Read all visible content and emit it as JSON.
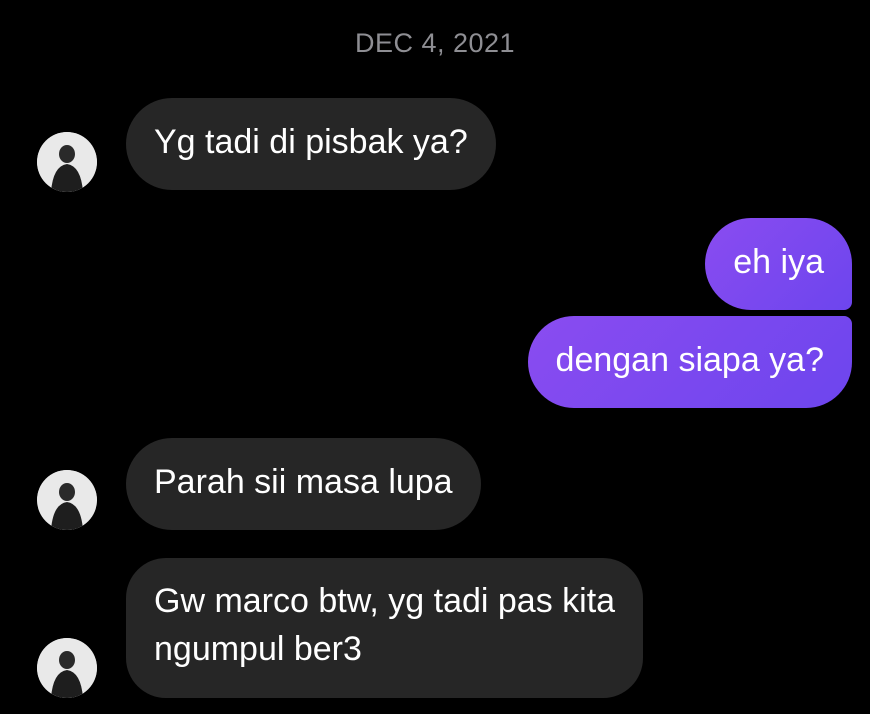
{
  "conversation": {
    "date_divider": "DEC 4, 2021",
    "messages": [
      {
        "direction": "incoming",
        "text": "Yg tadi di pisbak ya?"
      },
      {
        "direction": "outgoing",
        "text": "eh iya"
      },
      {
        "direction": "outgoing",
        "text": "dengan siapa ya?"
      },
      {
        "direction": "incoming",
        "text": "Parah sii masa lupa"
      },
      {
        "direction": "incoming",
        "text": "Gw marco btw, yg tadi pas kita",
        "text_line2": "ngumpul ber3"
      }
    ]
  },
  "colors": {
    "background": "#000000",
    "incoming_bubble": "#262626",
    "outgoing_bubble_start": "#8a4cf0",
    "outgoing_bubble_end": "#6d45ee",
    "date_text": "#8e8e93"
  },
  "icons": {
    "avatar": "contact-avatar-icon"
  }
}
